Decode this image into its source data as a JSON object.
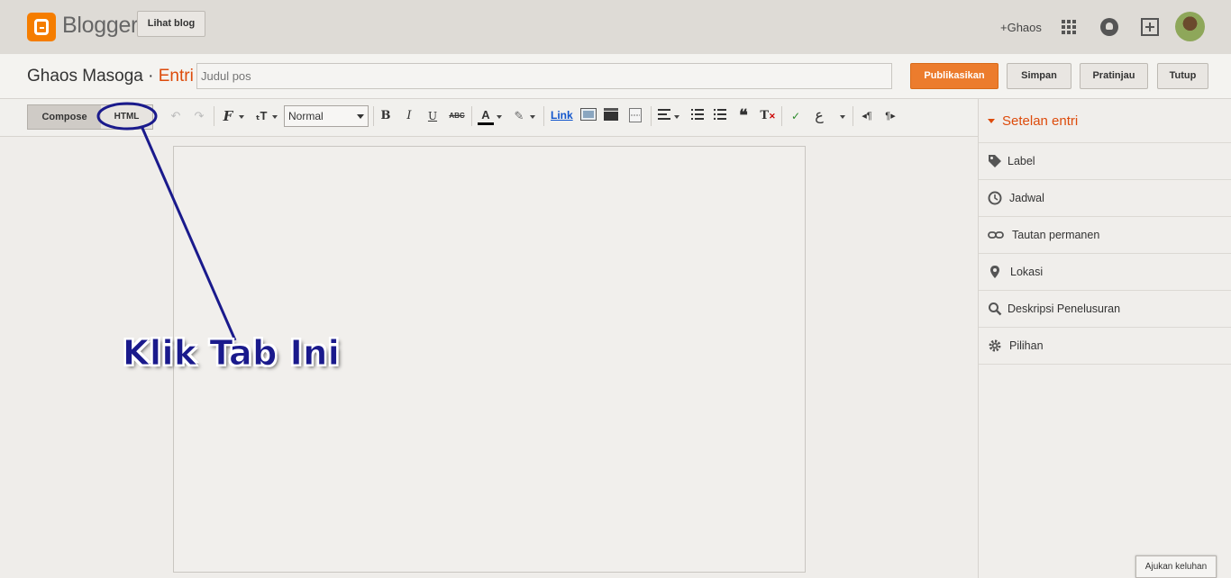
{
  "topbar": {
    "brand": "Blogger",
    "view_blog": "Lihat blog",
    "user": "+Ghaos"
  },
  "post": {
    "blog_name": "Ghaos Masoga · ",
    "section": "Entri",
    "title_placeholder": "Judul pos",
    "publish": "Publikasikan",
    "save": "Simpan",
    "preview": "Pratinjau",
    "close": "Tutup"
  },
  "toolbar": {
    "compose_tab": "Compose",
    "html_tab": "HTML",
    "format_value": "Normal",
    "link_label": "Link"
  },
  "sidebar": {
    "title": "Setelan entri",
    "items": [
      {
        "label": "Label",
        "icon": "tag-icon"
      },
      {
        "label": "Jadwal",
        "icon": "clock-icon"
      },
      {
        "label": "Tautan permanen",
        "icon": "link-icon"
      },
      {
        "label": "Lokasi",
        "icon": "location-pin-icon"
      },
      {
        "label": "Deskripsi Penelusuran",
        "icon": "search-icon"
      },
      {
        "label": "Pilihan",
        "icon": "gear-icon"
      }
    ]
  },
  "feedback": "Ajukan keluhan",
  "annotation": {
    "text": "Klik Tab Ini",
    "color": "#1a1a8c"
  },
  "colors": {
    "accent": "#dd4b0b",
    "publish": "#ec7c2d",
    "topbar_bg": "#dedbd6"
  }
}
